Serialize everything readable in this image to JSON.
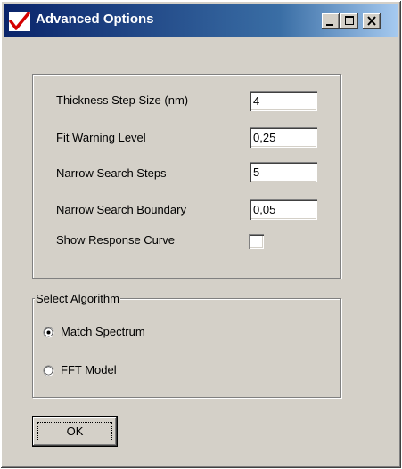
{
  "window": {
    "title": "Advanced Options",
    "controls": [
      "minimize-icon",
      "maximize-icon",
      "close-icon"
    ]
  },
  "fields": [
    {
      "label": "Thickness Step Size (nm)",
      "value": "4"
    },
    {
      "label": "Fit Warning Level",
      "value": "0,25"
    },
    {
      "label": "Narrow Search Steps",
      "value": "5"
    },
    {
      "label": "Narrow Search Boundary",
      "value": "0,05"
    }
  ],
  "show_response_curve": {
    "label": "Show Response Curve",
    "checked": false
  },
  "algorithm": {
    "legend": "Select Algorithm",
    "options": [
      {
        "label": "Match Spectrum",
        "selected": true
      },
      {
        "label": "FFT Model",
        "selected": false
      }
    ]
  },
  "ok_button": {
    "label": "OK"
  },
  "colors": {
    "face": "#d4d0c8",
    "title_start": "#0a246a",
    "title_end": "#a6caf0",
    "app_icon": "#d40000"
  }
}
